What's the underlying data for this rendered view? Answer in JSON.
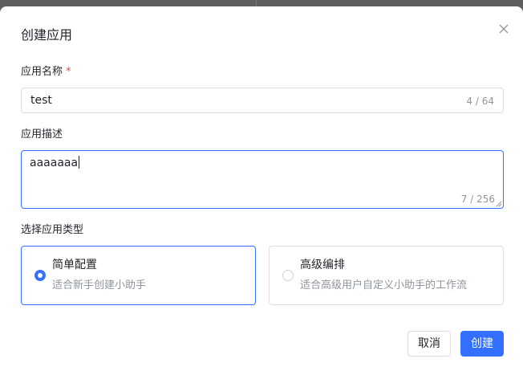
{
  "dialog": {
    "title": "创建应用",
    "close_icon": "close-icon"
  },
  "form": {
    "name_label": "应用名称",
    "required_mark": "*",
    "name_value": "test",
    "name_count": "4 / 64",
    "desc_label": "应用描述",
    "desc_value": "aaaaaaa",
    "desc_count": "7 / 256",
    "type_label": "选择应用类型"
  },
  "types": [
    {
      "title": "简单配置",
      "desc": "适合新手创建小助手",
      "selected": true
    },
    {
      "title": "高级编排",
      "desc": "适合高级用户自定义小助手的工作流",
      "selected": false
    }
  ],
  "footer": {
    "cancel_label": "取消",
    "create_label": "创建"
  },
  "colors": {
    "accent": "#3370ff",
    "required": "#e5484d",
    "muted_text": "#8f959e"
  }
}
